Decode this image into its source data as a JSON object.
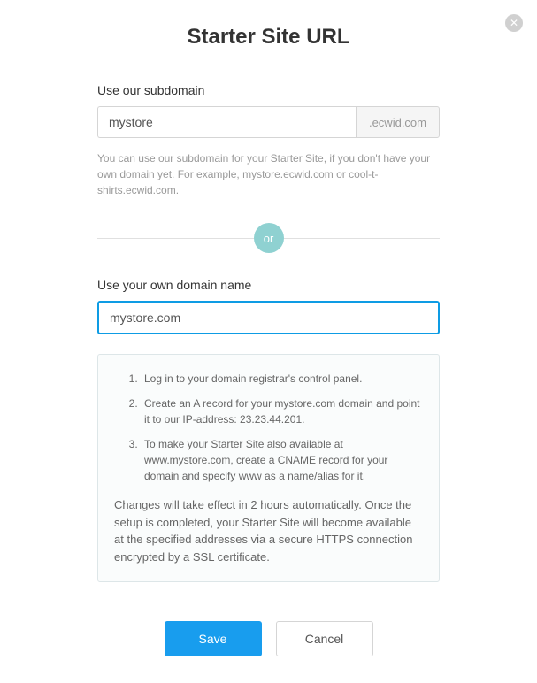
{
  "title": "Starter Site URL",
  "subdomain": {
    "label": "Use our subdomain",
    "value": "mystore",
    "suffix": ".ecwid.com",
    "help": "You can use our subdomain for your Starter Site, if you don't have your own domain yet. For example, mystore.ecwid.com or cool-t-shirts.ecwid.com."
  },
  "divider": {
    "or": "or"
  },
  "own_domain": {
    "label": "Use your own domain name",
    "value": "mystore.com"
  },
  "instructions": {
    "step1": "Log in to your domain registrar's control panel.",
    "step2": "Create an A record for your mystore.com domain and point it to our IP-address: 23.23.44.201.",
    "step3": "To make your Starter Site also available at www.mystore.com, create a CNAME record for your domain and specify www as a name/alias for it.",
    "note": "Changes will take effect in 2 hours automatically. Once the setup is completed, your Starter Site will become available at the specified addresses via a secure HTTPS connection encrypted by a SSL certificate."
  },
  "buttons": {
    "save": "Save",
    "cancel": "Cancel"
  }
}
